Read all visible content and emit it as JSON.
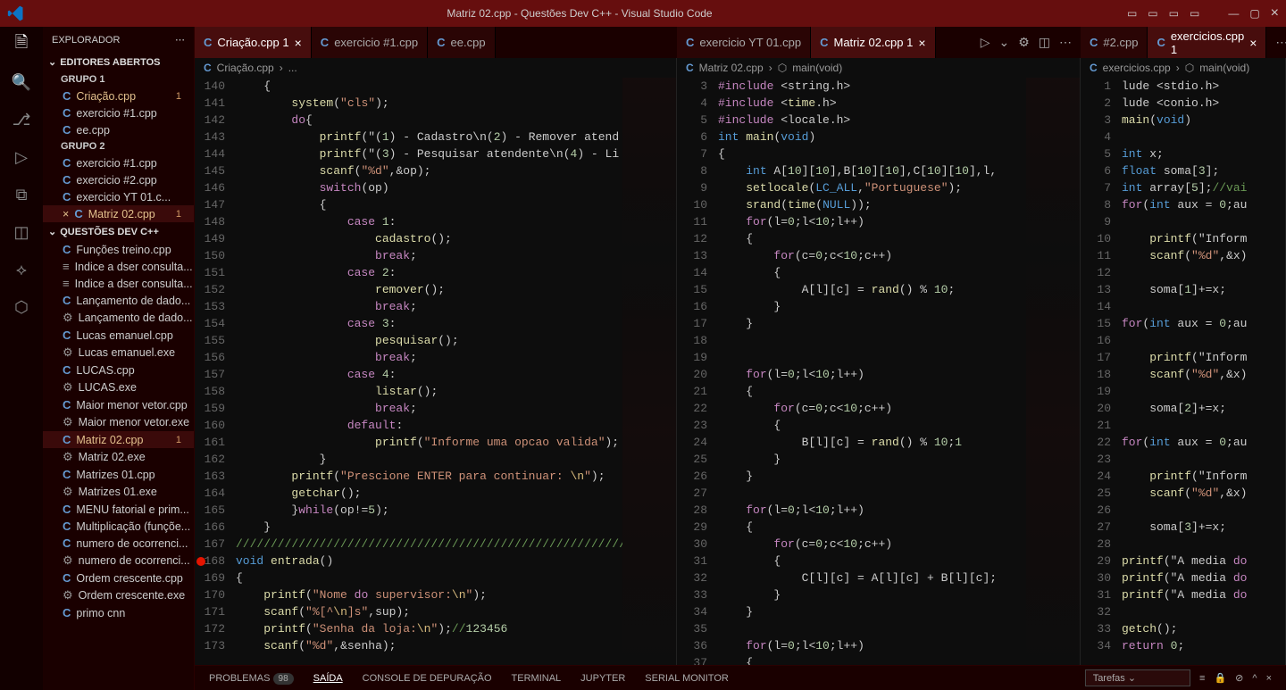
{
  "window": {
    "title": "Matriz 02.cpp - Questões Dev C++ - Visual Studio Code"
  },
  "sidebar": {
    "header": "EXPLORADOR",
    "open_editors": "EDITORES ABERTOS",
    "group1": "GRUPO 1",
    "group2": "GRUPO 2",
    "project": "QUESTÕES DEV C++",
    "g1": [
      {
        "name": "Criação.cpp",
        "badge": "1",
        "mod": true
      },
      {
        "name": "exercicio #1.cpp"
      },
      {
        "name": "ee.cpp"
      }
    ],
    "g2": [
      {
        "name": "exercicio #1.cpp"
      },
      {
        "name": "exercicio #2.cpp"
      },
      {
        "name": "exercicio YT 01.c..."
      },
      {
        "name": "Matriz 02.cpp",
        "badge": "1",
        "mod": true,
        "active": true
      }
    ],
    "files": [
      {
        "name": "Funções treino.cpp",
        "icon": "cpp"
      },
      {
        "name": "Indice a dser consulta...",
        "icon": "txt"
      },
      {
        "name": "Indice a dser consulta...",
        "icon": "txt"
      },
      {
        "name": "Lançamento de dado...",
        "icon": "cpp"
      },
      {
        "name": "Lançamento de dado...",
        "icon": "exe"
      },
      {
        "name": "Lucas emanuel.cpp",
        "icon": "cpp"
      },
      {
        "name": "Lucas emanuel.exe",
        "icon": "exe"
      },
      {
        "name": "LUCAS.cpp",
        "icon": "cpp"
      },
      {
        "name": "LUCAS.exe",
        "icon": "exe"
      },
      {
        "name": "Maior menor vetor.cpp",
        "icon": "cpp"
      },
      {
        "name": "Maior menor vetor.exe",
        "icon": "exe"
      },
      {
        "name": "Matriz 02.cpp",
        "icon": "cpp",
        "badge": "1",
        "mod": true,
        "active": true
      },
      {
        "name": "Matriz 02.exe",
        "icon": "exe"
      },
      {
        "name": "Matrizes 01.cpp",
        "icon": "cpp"
      },
      {
        "name": "Matrizes 01.exe",
        "icon": "exe"
      },
      {
        "name": "MENU fatorial e prim...",
        "icon": "cpp"
      },
      {
        "name": "Multiplicação (funçõe...",
        "icon": "cpp"
      },
      {
        "name": "numero de ocorrenci...",
        "icon": "cpp"
      },
      {
        "name": "numero de ocorrenci...",
        "icon": "exe"
      },
      {
        "name": "Ordem crescente.cpp",
        "icon": "cpp"
      },
      {
        "name": "Ordem crescente.exe",
        "icon": "exe"
      },
      {
        "name": "primo cnn",
        "icon": "cpp"
      }
    ]
  },
  "tabs_top": [
    {
      "label": "Criação.cpp",
      "badge": "1",
      "active": true
    },
    {
      "label": "exercicio #1.cpp"
    },
    {
      "label": "ee.cpp"
    }
  ],
  "tabs_mid": [
    {
      "label": "exercicio YT 01.cpp"
    },
    {
      "label": "Matriz 02.cpp",
      "badge": "1",
      "active": true
    }
  ],
  "tabs_right": [
    {
      "label": "#2.cpp"
    },
    {
      "label": "exercicios.cpp",
      "badge": "1",
      "active": true
    }
  ],
  "breadcrumbs": {
    "left": [
      "Criação.cpp",
      "..."
    ],
    "mid": [
      "Matriz 02.cpp",
      "main(void)"
    ],
    "right": [
      "exercicios.cpp",
      "main(void)"
    ]
  },
  "editor1": {
    "start": 140,
    "lines": [
      "    {",
      "        system(\"cls\");",
      "        do{",
      "            printf(\"(1) - Cadastro\\n(2) - Remover atend",
      "            printf(\"(3) - Pesquisar atendente\\n(4) - Li",
      "            scanf(\"%d\",&op);",
      "            switch(op)",
      "            {",
      "                case 1:",
      "                    cadastro();",
      "                    break;",
      "                case 2:",
      "                    remover();",
      "                    break;",
      "                case 3:",
      "                    pesquisar();",
      "                    break;",
      "                case 4:",
      "                    listar();",
      "                    break;",
      "                default:",
      "                    printf(\"Informe uma opcao valida\");",
      "            }",
      "        printf(\"Prescione ENTER para continuar: \\n\");",
      "        getchar();",
      "        }while(op!=5);",
      "    }",
      "////////////////////////////////////////////////////////",
      "void entrada()",
      "{",
      "    printf(\"Nome do supervisor:\\n\");",
      "    scanf(\"%[^\\n]s\",sup);",
      "    printf(\"Senha da loja:\\n\");//123456",
      "    scanf(\"%d\",&senha);"
    ]
  },
  "editor2": {
    "start": 3,
    "lines": [
      "#include <string.h>",
      "#include <time.h>",
      "#include <locale.h>",
      "int main(void)",
      "{",
      "    int A[10][10],B[10][10],C[10][10],l,",
      "    setlocale(LC_ALL,\"Portuguese\");",
      "    srand(time(NULL));",
      "    for(l=0;l<10;l++)",
      "    {",
      "        for(c=0;c<10;c++)",
      "        {",
      "            A[l][c] = rand() % 10;",
      "        }",
      "    }",
      "",
      "",
      "    for(l=0;l<10;l++)",
      "    {",
      "        for(c=0;c<10;c++)",
      "        {",
      "            B[l][c] = rand() % 10;1",
      "        }",
      "    }",
      "",
      "    for(l=0;l<10;l++)",
      "    {",
      "        for(c=0;c<10;c++)",
      "        {",
      "            C[l][c] = A[l][c] + B[l][c];",
      "        }",
      "    }",
      "",
      "    for(l=0;l<10;l++)",
      "    {"
    ]
  },
  "editor3": {
    "start": 1,
    "lines": [
      "lude <stdio.h>",
      "lude <conio.h>",
      "main(void)",
      "",
      "int x;",
      "float soma[3];",
      "int array[5];//vai",
      "for(int aux = 0;au",
      "",
      "    printf(\"Inform",
      "    scanf(\"%d\",&x)",
      "",
      "    soma[1]+=x;",
      "",
      "for(int aux = 0;au",
      "",
      "    printf(\"Inform",
      "    scanf(\"%d\",&x)",
      "",
      "    soma[2]+=x;",
      "",
      "for(int aux = 0;au",
      "",
      "    printf(\"Inform",
      "    scanf(\"%d\",&x)",
      "",
      "    soma[3]+=x;",
      "",
      "printf(\"A media do",
      "printf(\"A media do",
      "printf(\"A media do",
      "",
      "getch();",
      "return 0;"
    ]
  },
  "panel": {
    "tabs": [
      "PROBLEMAS",
      "SAÍDA",
      "CONSOLE DE DEPURAÇÃO",
      "TERMINAL",
      "JUPYTER",
      "SERIAL MONITOR"
    ],
    "problems_count": "98",
    "tarefas": "Tarefas"
  }
}
